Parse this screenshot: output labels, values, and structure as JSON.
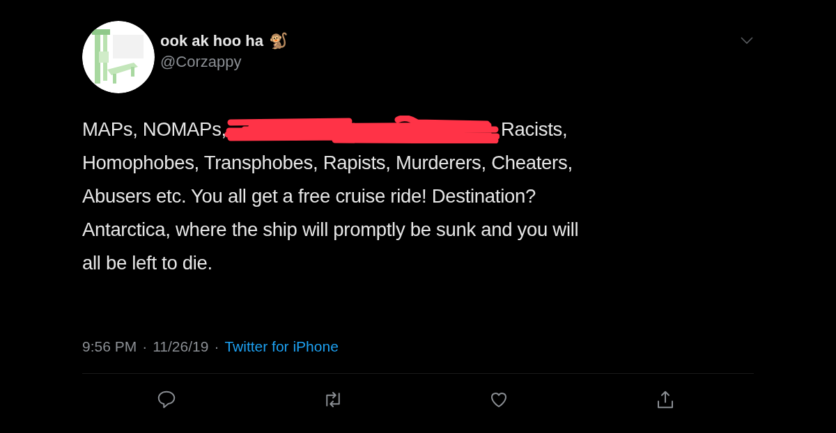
{
  "tweet": {
    "author": {
      "display_name": "ook ak hoo ha",
      "emoji": "🐒",
      "handle": "@Corzappy"
    },
    "body": {
      "before_redaction": "MAPs, NOMAPs,",
      "redacted": true,
      "after_redaction": "Racists,",
      "lines": [
        "Homophobes, Transphobes, Rapists, Murderers, Cheaters,",
        "Abusers etc. You all get a free cruise ride! Destination?",
        "Antarctica, where the ship will promptly be sunk and you will",
        "all be left to die."
      ]
    },
    "meta": {
      "time": "9:56 PM",
      "separator": "·",
      "date": "11/26/19",
      "source": "Twitter for iPhone"
    },
    "actions": [
      {
        "kind": "reply"
      },
      {
        "kind": "retweet"
      },
      {
        "kind": "like"
      },
      {
        "kind": "share"
      }
    ]
  }
}
